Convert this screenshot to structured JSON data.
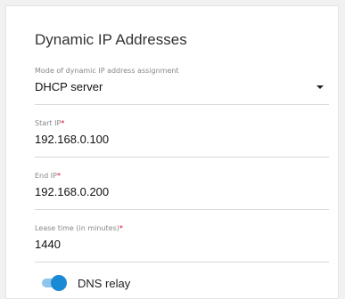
{
  "title": "Dynamic IP Addresses",
  "mode": {
    "label": "Mode of dynamic IP address assignment",
    "value": "DHCP server"
  },
  "start_ip": {
    "label": "Start IP",
    "required_mark": "*",
    "value": "192.168.0.100"
  },
  "end_ip": {
    "label": "End IP",
    "required_mark": "*",
    "value": "192.168.0.200"
  },
  "lease_time": {
    "label": "Lease time (in minutes)",
    "required_mark": "*",
    "value": "1440"
  },
  "dns_relay": {
    "label": "DNS relay",
    "enabled": true
  },
  "colors": {
    "accent": "#1a8ad6",
    "required": "#e8002a"
  }
}
